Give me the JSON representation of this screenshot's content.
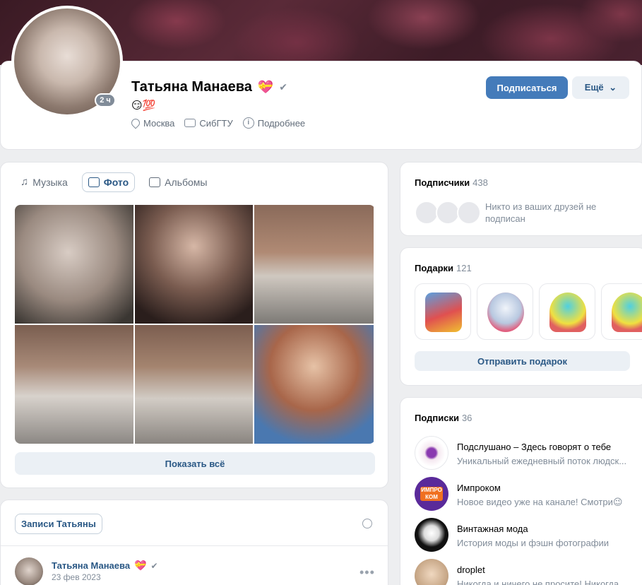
{
  "profile": {
    "name": "Татьяна Манаева",
    "name_emoji": "💝",
    "status": "😏💯",
    "online": "2 ч",
    "city": "Москва",
    "university": "СибГТУ",
    "more_info": "Подробнее",
    "subscribe_label": "Подписаться",
    "more_label": "Ещё",
    "more_chevron": "⌄"
  },
  "media_tabs": [
    {
      "label": "Музыка",
      "icon": "music-icon"
    },
    {
      "label": "Фото",
      "icon": "photo-icon"
    },
    {
      "label": "Альбомы",
      "icon": "albums-icon"
    }
  ],
  "photos": {
    "show_all_label": "Показать всё"
  },
  "posts": {
    "tab_label": "Записи Татьяны",
    "author": "Татьяна Манаева",
    "author_emoji": "💝",
    "date": "23 фев 2023",
    "more": "•••"
  },
  "subscribers": {
    "title": "Подписчики",
    "count": "438",
    "empty_text": "Никто из ваших друзей не подписан"
  },
  "gifts": {
    "title": "Подарки",
    "count": "121",
    "send_label": "Отправить подарок"
  },
  "subscriptions": {
    "title": "Подписки",
    "count": "36",
    "items": [
      {
        "name": "Подслушано – Здесь говорят о тебе",
        "desc": "Уникальный ежедневный поток людск..."
      },
      {
        "name": "Импроком",
        "desc": "Новое видео уже на канале! Смотри😉",
        "logo_text": "ИМПРО КОМ"
      },
      {
        "name": "Винтажная мода",
        "desc": "История моды и фэшн фотографии"
      },
      {
        "name": "droplet",
        "desc": "Никогда и ничего не просите! Никогда..."
      }
    ]
  },
  "colors": {
    "accent": "#447bba",
    "link": "#2a5885",
    "secondary_bg": "#ebf0f5",
    "muted_text": "#818c99",
    "page_bg": "#edeef0"
  }
}
